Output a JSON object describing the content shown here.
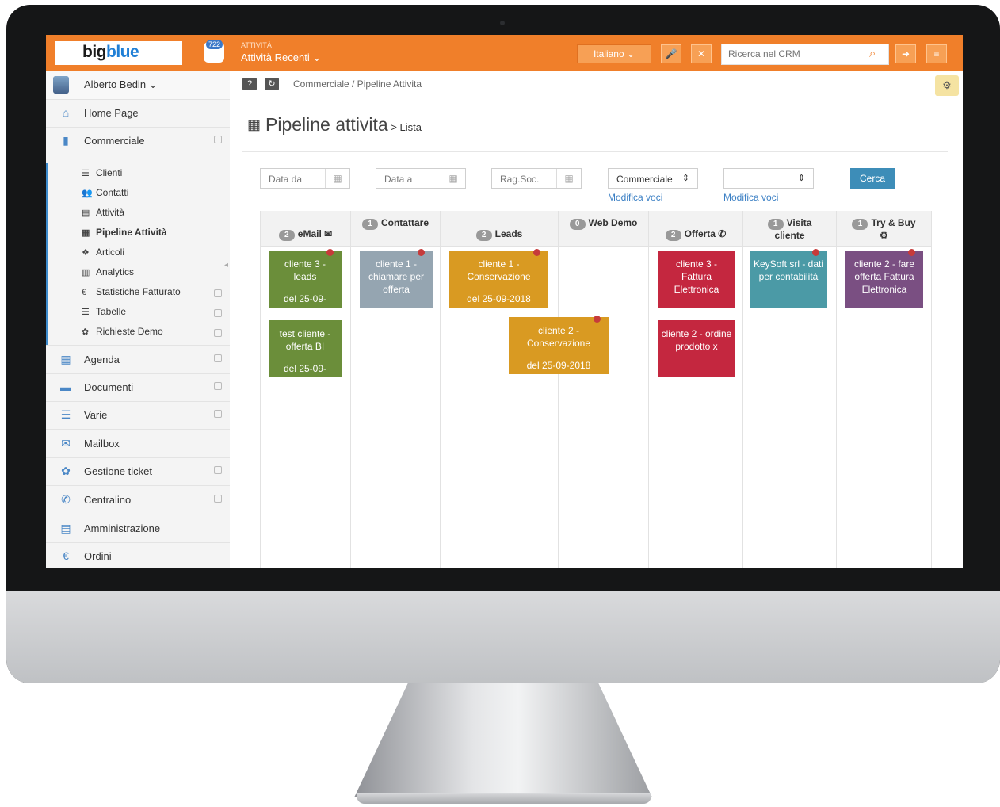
{
  "app": {
    "logo_part1": "big",
    "logo_part2": "blue",
    "notif_count": "722",
    "activity_label": "ATTIVITÀ",
    "activity_value": "Attività Recenti ⌄",
    "language": "Italiano ⌄",
    "search_placeholder": "Ricerca nel CRM"
  },
  "sidebar": {
    "user": "Alberto Bedin ⌄",
    "items": [
      {
        "label": "Home Page",
        "icon": "home-icon"
      },
      {
        "label": "Commerciale",
        "icon": "briefcase-icon"
      },
      {
        "label": "Agenda",
        "icon": "calendar-icon"
      },
      {
        "label": "Documenti",
        "icon": "folder-icon"
      },
      {
        "label": "Varie",
        "icon": "list-icon"
      },
      {
        "label": "Mailbox",
        "icon": "mail-icon"
      },
      {
        "label": "Gestione ticket",
        "icon": "gear-icon"
      },
      {
        "label": "Centralino",
        "icon": "phone-icon"
      },
      {
        "label": "Amministrazione",
        "icon": "admin-icon"
      },
      {
        "label": "Ordini",
        "icon": "euro-icon"
      }
    ],
    "sub_items": [
      {
        "label": "Clienti",
        "icon": "list-icon"
      },
      {
        "label": "Contatti",
        "icon": "contacts-icon"
      },
      {
        "label": "Attività",
        "icon": "activity-icon"
      },
      {
        "label": "Pipeline Attività",
        "icon": "table-icon"
      },
      {
        "label": "Articoli",
        "icon": "cubes-icon"
      },
      {
        "label": "Analytics",
        "icon": "chart-icon"
      },
      {
        "label": "Statistiche Fatturato",
        "icon": "euro-icon"
      },
      {
        "label": "Tabelle",
        "icon": "list-icon"
      },
      {
        "label": "Richieste Demo",
        "icon": "gear-icon"
      }
    ]
  },
  "main": {
    "breadcrumb": "Commerciale  /  Pipeline Attivita",
    "title": "Pipeline attivita",
    "title_sub": " > Lista",
    "filters": {
      "date_from": "Data da",
      "date_to": "Data a",
      "rag_soc": "Rag.Soc.",
      "commerciale": "Commerciale",
      "empty_select": "",
      "modifica1": "Modifica voci",
      "modifica2": "Modifica voci",
      "search_btn": "Cerca"
    },
    "columns": [
      {
        "count": "2",
        "title": "eMail ✉"
      },
      {
        "count": "1",
        "title": "Contattare"
      },
      {
        "count": "2",
        "title": "Leads"
      },
      {
        "count": "0",
        "title": "Web Demo"
      },
      {
        "count": "2",
        "title": "Offerta ✆"
      },
      {
        "count": "1",
        "title": "Visita",
        "title2": "cliente"
      },
      {
        "count": "1",
        "title": "Try & Buy",
        "title2": "⚙"
      }
    ],
    "cards": [
      {
        "text": "cliente 3 - leads",
        "date": "del 25-09-",
        "color": "#6b8e3a"
      },
      {
        "text": "test cliente - offerta BI",
        "date": "del 25-09-",
        "color": "#6b8e3a"
      },
      {
        "text": "cliente 1 - chiamare per offerta",
        "date": "",
        "color": "#95a5b1"
      },
      {
        "text": "cliente 1 - Conservazione",
        "date": "del 25-09-2018",
        "color": "#d99a22"
      },
      {
        "text": "cliente 2 - Conservazione",
        "date": "del 25-09-2018",
        "color": "#d99a22"
      },
      {
        "text": "cliente 3 - Fattura Elettronica",
        "date": "",
        "color": "#c4273f"
      },
      {
        "text": "cliente 2 - ordine prodotto x",
        "date": "",
        "color": "#c4273f"
      },
      {
        "text": "KeySoft srl - dati per contabilità",
        "date": "",
        "color": "#4b9aa6"
      },
      {
        "text": "cliente 2 - fare offerta Fattura Elettronica",
        "date": "",
        "color": "#7a4f82"
      }
    ]
  }
}
